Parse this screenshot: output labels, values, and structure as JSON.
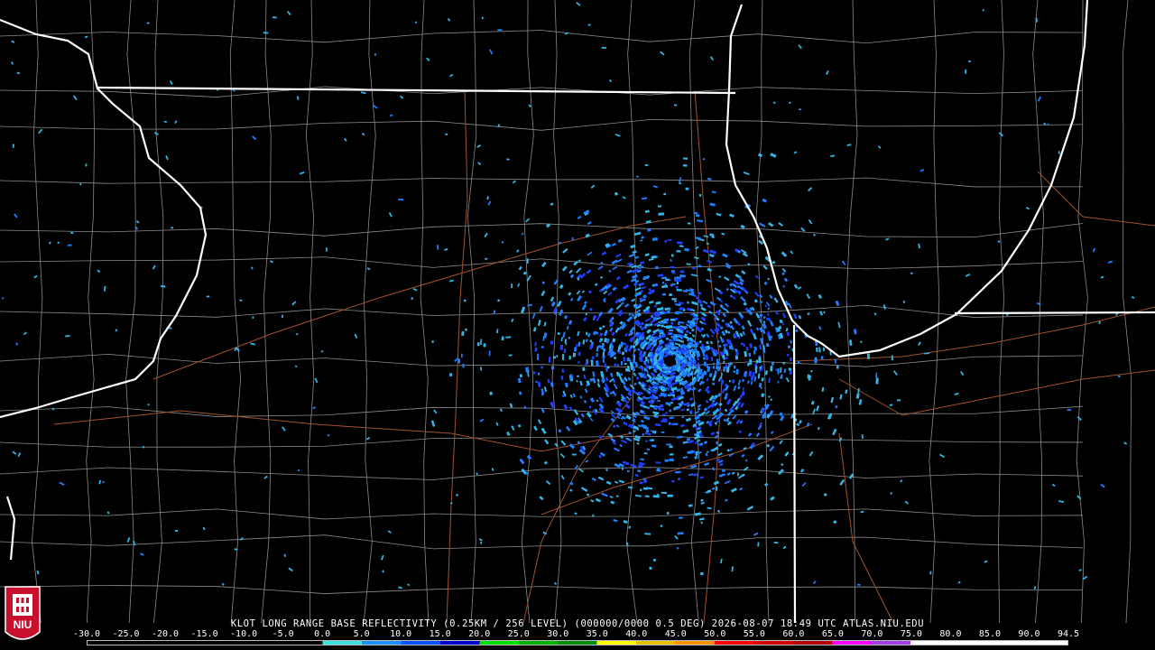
{
  "caption": "KLOT LONG RANGE BASE REFLECTIVITY (0.25KM / 256 LEVEL) (000000/0000 0.5 DEG) 2026-08-07 18:49 UTC  ATLAS.NIU.EDU",
  "logo": {
    "text": "NIU",
    "icon": "niu-shield-logo-icon",
    "color": "#c8102e"
  },
  "scale": {
    "labels": [
      "-30.0",
      "-25.0",
      "-20.0",
      "-15.0",
      "-10.0",
      "-5.0",
      "0.0",
      "5.0",
      "10.0",
      "15.0",
      "20.0",
      "25.0",
      "30.0",
      "35.0",
      "40.0",
      "45.0",
      "50.0",
      "55.0",
      "60.0",
      "65.0",
      "70.0",
      "75.0",
      "80.0",
      "85.0",
      "90.0",
      "94.5"
    ],
    "colors": [
      "#000000",
      "#000000",
      "#000000",
      "#000000",
      "#000000",
      "#000000",
      "#40e0e0",
      "#1e90ff",
      "#0050ff",
      "#0000c8",
      "#00e000",
      "#00b400",
      "#008c00",
      "#ffff00",
      "#e6c000",
      "#ff9000",
      "#ff0000",
      "#d20000",
      "#b40000",
      "#ff00ff",
      "#a040e0",
      "#ffffff",
      "#ffffff",
      "#ffffff",
      "#ffffff"
    ]
  },
  "map": {
    "radar_site": "KLOT",
    "colors": {
      "state_border": "#ffffff",
      "county_line": "#8a8a8a",
      "highway": "#a0522d",
      "echo_light": "#33b5e5",
      "echo_mid": "#1e7fff",
      "echo_strong": "#2040ff"
    }
  }
}
